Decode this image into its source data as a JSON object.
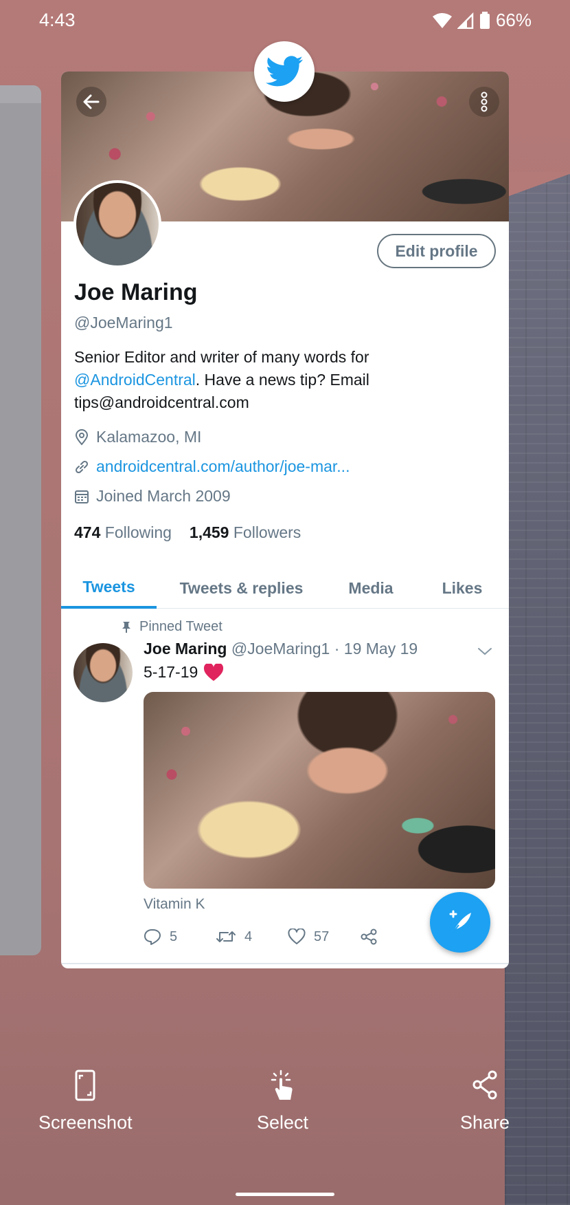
{
  "status_bar": {
    "time": "4:43",
    "battery": "66%"
  },
  "profile": {
    "edit_button": "Edit profile",
    "name": "Joe Maring",
    "handle": "@JoeMaring1",
    "bio_part1": "Senior Editor and writer of many words for",
    "bio_mention": "@AndroidCentral",
    "bio_part2": ". Have a news tip? Email",
    "bio_part3": "tips@androidcentral.com",
    "location": "Kalamazoo, MI",
    "website": "androidcentral.com/author/joe-mar...",
    "joined": "Joined March 2009",
    "following_count": "474",
    "following_label": "Following",
    "followers_count": "1,459",
    "followers_label": "Followers"
  },
  "tabs": [
    {
      "label": "Tweets",
      "active": true
    },
    {
      "label": "Tweets & replies",
      "active": false
    },
    {
      "label": "Media",
      "active": false
    },
    {
      "label": "Likes",
      "active": false
    }
  ],
  "tweet": {
    "pinned_label": "Pinned Tweet",
    "author": "Joe Maring",
    "meta": "@JoeMaring1 · 19 May 19",
    "text": "5-17-19",
    "caption": "Vitamin K",
    "replies": "5",
    "retweets": "4",
    "likes": "57"
  },
  "bottom_actions": {
    "screenshot": "Screenshot",
    "select": "Select",
    "share": "Share"
  },
  "colors": {
    "twitter_blue": "#1da1f2",
    "link_blue": "#1b95e0",
    "secondary_text": "#657786",
    "heart_red": "#e0245e"
  }
}
